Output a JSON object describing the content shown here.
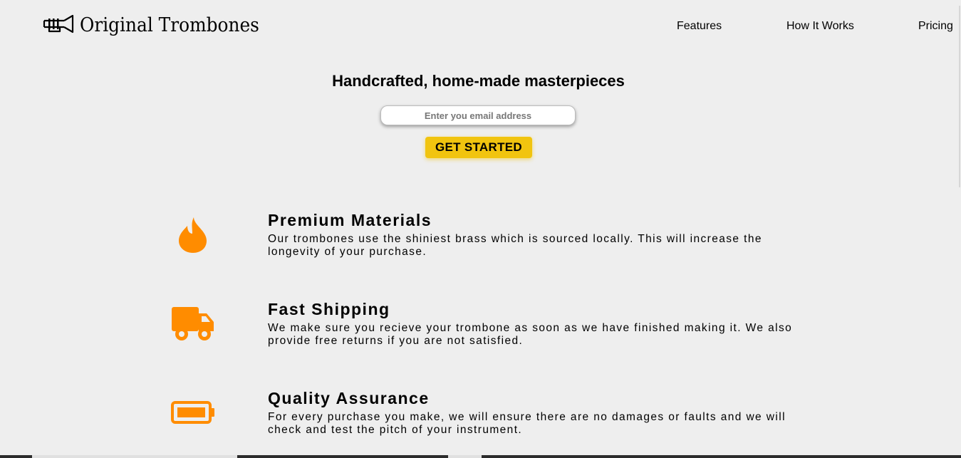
{
  "header": {
    "logo_text": "Original Trombones",
    "logo_icon": "trombone-icon",
    "nav": [
      {
        "label": "Features"
      },
      {
        "label": "How It Works"
      },
      {
        "label": "Pricing"
      }
    ]
  },
  "hero": {
    "title": "Handcrafted, home-made masterpieces",
    "email_placeholder": "Enter you email address",
    "email_value": "",
    "cta_label": "GET STARTED"
  },
  "features": [
    {
      "icon": "fire-icon",
      "title": "Premium Materials",
      "description": "Our trombones use the shiniest brass which is sourced locally. This will increase the longevity of your purchase."
    },
    {
      "icon": "truck-icon",
      "title": "Fast Shipping",
      "description": "We make sure you recieve your trombone as soon as we have finished making it. We also provide free returns if you are not satisfied."
    },
    {
      "icon": "battery-icon",
      "title": "Quality Assurance",
      "description": "For every purchase you make, we will ensure there are no damages or faults and we will check and test the pitch of your instrument."
    }
  ],
  "colors": {
    "background": "#eeeeee",
    "accent_orange": "#ff8c00",
    "cta_yellow": "#f1c40f",
    "text": "#000000"
  }
}
